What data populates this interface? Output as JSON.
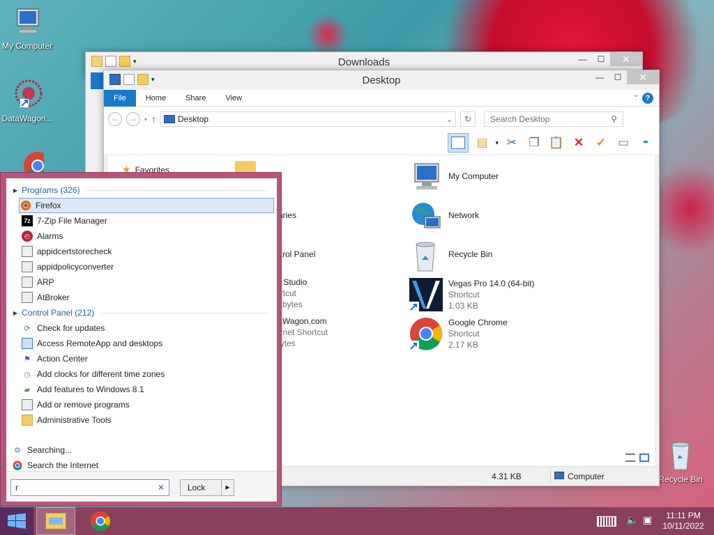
{
  "desktop": {
    "icons": [
      {
        "label": "My Computer"
      },
      {
        "label": "DataWagon..."
      },
      {
        "label": "Recycle Bin"
      }
    ]
  },
  "downloads_window": {
    "title": "Downloads"
  },
  "explorer": {
    "title": "Desktop",
    "tabs": [
      "File",
      "Home",
      "Share",
      "View"
    ],
    "address": "Desktop",
    "search_placeholder": "Search Desktop",
    "sidebar": {
      "favorites": "Favorites"
    },
    "items": [
      {
        "name": "My Computer",
        "line2": "",
        "line3": ""
      },
      {
        "name": "Network",
        "line2": "",
        "line3": ""
      },
      {
        "name": "Recycle Bin",
        "line2": "",
        "line3": ""
      },
      {
        "name": "Vegas Pro 14.0 (64-bit)",
        "line2": "Shortcut",
        "line3": "1.03 KB"
      },
      {
        "name": "Google Chrome",
        "line2": "Shortcut",
        "line3": "2.17 KB"
      }
    ],
    "partial_items": [
      {
        "name": "4",
        "line2": "",
        "line3": ""
      },
      {
        "name": "raries",
        "line2": "",
        "line3": ""
      },
      {
        "name": "ntrol Panel",
        "line2": "",
        "line3": ""
      },
      {
        "name": "S Studio",
        "line2": "ortcut",
        "line3": "3 bytes"
      },
      {
        "name": "taWagon.com",
        "line2": "ernet Shortcut",
        "line3": "bytes"
      }
    ],
    "status": {
      "size": "4.31 KB",
      "location": "Computer"
    }
  },
  "start_menu": {
    "groups": [
      {
        "label": "Programs (326)",
        "items": [
          "Firefox",
          "7-Zip File Manager",
          "Alarms",
          "appidcertstorecheck",
          "appidpolicyconverter",
          "ARP",
          "AtBroker"
        ]
      },
      {
        "label": "Control Panel (212)",
        "items": [
          "Check for updates",
          "Access RemoteApp and desktops",
          "Action Center",
          "Add clocks for different time zones",
          "Add features to Windows 8.1",
          "Add or remove programs",
          "Administrative Tools"
        ]
      }
    ],
    "footer": [
      "Searching...",
      "Search the Internet"
    ],
    "search_value": "r",
    "lock_label": "Lock"
  },
  "taskbar": {
    "time": "11:11 PM",
    "date": "10/11/2022"
  },
  "colors": {
    "start_border": "#b8547c",
    "taskbar": "#8a3f5d",
    "file_tab": "#1979ca"
  }
}
